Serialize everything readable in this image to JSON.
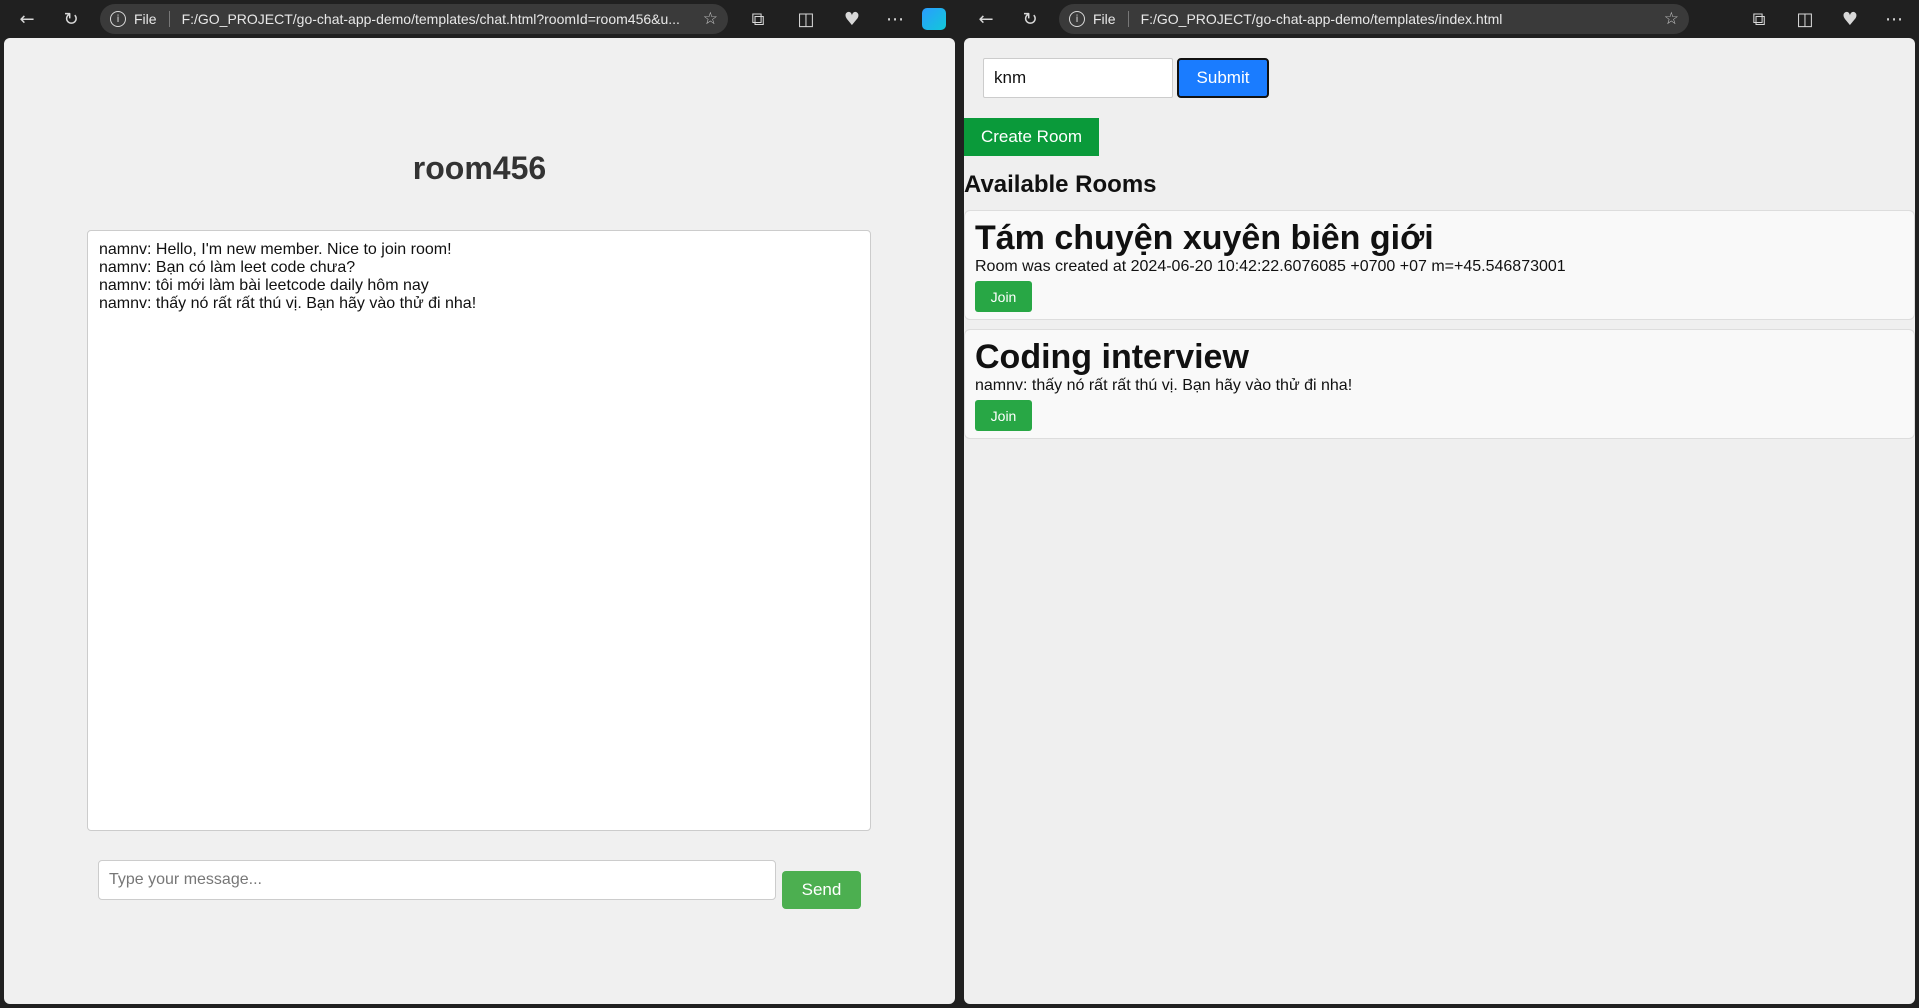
{
  "left_browser": {
    "address_prefix": "File",
    "url": "F:/GO_PROJECT/go-chat-app-demo/templates/chat.html?roomId=room456&u..."
  },
  "right_browser": {
    "address_prefix": "File",
    "url": "F:/GO_PROJECT/go-chat-app-demo/templates/index.html"
  },
  "chat": {
    "room_title": "room456",
    "messages": [
      "namnv: Hello, I'm new member. Nice to join room!",
      "namnv: Bạn có làm leet code chưa?",
      "namnv: tôi mới làm bài leetcode daily hôm nay",
      "namnv: thấy nó rất rất thú vị. Bạn hãy vào thử đi nha!"
    ],
    "input_placeholder": "Type your message...",
    "send_label": "Send"
  },
  "index": {
    "name_value": "knm",
    "submit_label": "Submit",
    "create_room_label": "Create Room",
    "rooms_heading": "Available Rooms",
    "rooms": [
      {
        "name": "Tám chuyện xuyên biên giới",
        "description": "Room was created at 2024-06-20 10:42:22.6076085 +0700 +07 m=+45.546873001",
        "join_label": "Join"
      },
      {
        "name": "Coding interview",
        "description": "namnv: thấy nó rất rất thú vị. Bạn hãy vào thử đi nha!",
        "join_label": "Join"
      }
    ]
  },
  "colors": {
    "send_button": "#4caf50",
    "submit_button": "#1a7cff",
    "create_room_button": "#0a9a3a",
    "join_button": "#28a745"
  }
}
